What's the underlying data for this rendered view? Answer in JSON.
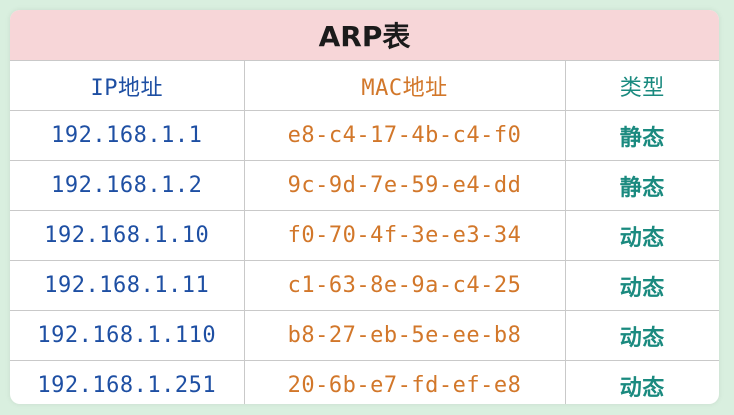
{
  "table": {
    "title": "ARP表",
    "headers": {
      "ip": "IP地址",
      "mac": "MAC地址",
      "type": "类型"
    },
    "rows": [
      {
        "ip": "192.168.1.1",
        "mac": "e8-c4-17-4b-c4-f0",
        "type": "静态"
      },
      {
        "ip": "192.168.1.2",
        "mac": "9c-9d-7e-59-e4-dd",
        "type": "静态"
      },
      {
        "ip": "192.168.1.10",
        "mac": "f0-70-4f-3e-e3-34",
        "type": "动态"
      },
      {
        "ip": "192.168.1.11",
        "mac": "c1-63-8e-9a-c4-25",
        "type": "动态"
      },
      {
        "ip": "192.168.1.110",
        "mac": "b8-27-eb-5e-ee-b8",
        "type": "动态"
      },
      {
        "ip": "192.168.1.251",
        "mac": "20-6b-e7-fd-ef-e8",
        "type": "动态"
      }
    ]
  },
  "colors": {
    "background": "#d9efdf",
    "title_band": "#f7d6d8",
    "ip_text": "#1e4fa3",
    "mac_text": "#d2772a",
    "type_text": "#1a8a7f"
  }
}
